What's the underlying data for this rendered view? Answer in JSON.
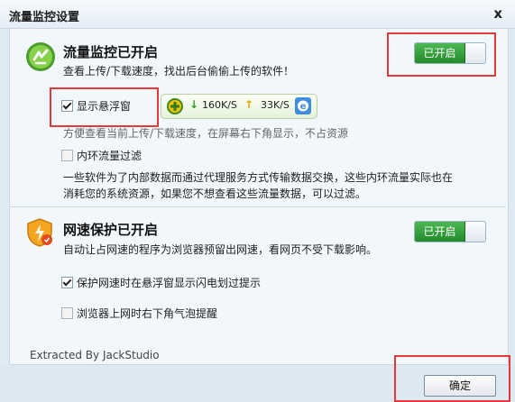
{
  "window": {
    "title": "流量监控设置",
    "close_label": "x"
  },
  "traffic": {
    "title": "流量监控已开启",
    "desc": "查看上传/下载速度，找出后台偷偷上传的软件！",
    "toggle_label": "已开启",
    "show_float_label": "显示悬浮窗",
    "show_float_checked": true,
    "float_down": "160K/S",
    "float_up": "33K/S",
    "float_desc": "方便查看当前上传/下载速度，在屏幕右下角显示，不占资源",
    "intranet_label": "内环流量过滤",
    "intranet_checked": false,
    "intranet_desc_1": "一些软件为了内部数据而通过代理服务方式传输数据交换，这些内环流量实际也在",
    "intranet_desc_2": "消耗您的系统资源，如果您不想查看这些流量数据，可以过滤。"
  },
  "speed": {
    "title": "网速保护已开启",
    "desc": "自动让占网速的程序为浏览器预留出网速，看网页不受下载影响。",
    "toggle_label": "已开启",
    "lightning_label": "保护网速时在悬浮窗显示闪电划过提示",
    "lightning_checked": true,
    "bubble_label": "浏览器上网时右下角气泡提醒",
    "bubble_checked": false
  },
  "footer": {
    "credit": "Extracted By JackStudio",
    "ok_label": "确定"
  },
  "colors": {
    "accent_green": "#2e9e37",
    "highlight_red": "#e53838"
  }
}
